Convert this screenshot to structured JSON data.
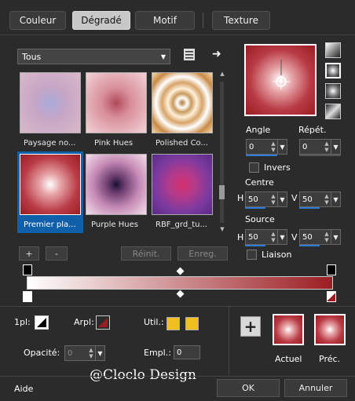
{
  "tabs": [
    {
      "label": "Couleur",
      "active": false
    },
    {
      "label": "Dégradé",
      "active": true
    },
    {
      "label": "Motif",
      "active": false
    },
    {
      "label": "Texture",
      "active": false
    }
  ],
  "category_select": {
    "value": "Tous"
  },
  "gradients": [
    {
      "label": "Paysage no...",
      "selected": false
    },
    {
      "label": "Pink Hues",
      "selected": false
    },
    {
      "label": "Polished Co...",
      "selected": false
    },
    {
      "label": "Premier pla...",
      "selected": true
    },
    {
      "label": "Purple Hues",
      "selected": false
    },
    {
      "label": "RBF_grd_tu...",
      "selected": false
    }
  ],
  "list_buttons": {
    "add": "+",
    "remove": "-",
    "reset": "Réinit.",
    "save": "Enreg."
  },
  "angle": {
    "label": "Angle",
    "value": "0"
  },
  "repeat": {
    "label": "Répét.",
    "value": "0"
  },
  "invert": {
    "label": "Invers",
    "checked": false
  },
  "center": {
    "label": "Centre",
    "h_label": "H",
    "h_value": "50",
    "v_label": "V",
    "v_value": "50"
  },
  "source": {
    "label": "Source",
    "h_label": "H",
    "h_value": "50",
    "v_label": "V",
    "v_value": "50"
  },
  "link": {
    "label": "Liaison",
    "checked": false
  },
  "gradient_colors": {
    "start": "#ffffff",
    "end": "#9b1d22",
    "accent": "#2d7bd6"
  },
  "bottom": {
    "first_plan_label": "1pl:",
    "arpl_label": "Arpl:",
    "util_label": "Util.:",
    "opacity_label": "Opacité:",
    "opacity_value": "0",
    "empl_label": "Empl.:",
    "empl_value": "0",
    "current_label": "Actuel",
    "previous_label": "Préc."
  },
  "watermark": "@Cloclo Design",
  "footer": {
    "help": "Aide",
    "ok": "OK",
    "cancel": "Annuler"
  }
}
